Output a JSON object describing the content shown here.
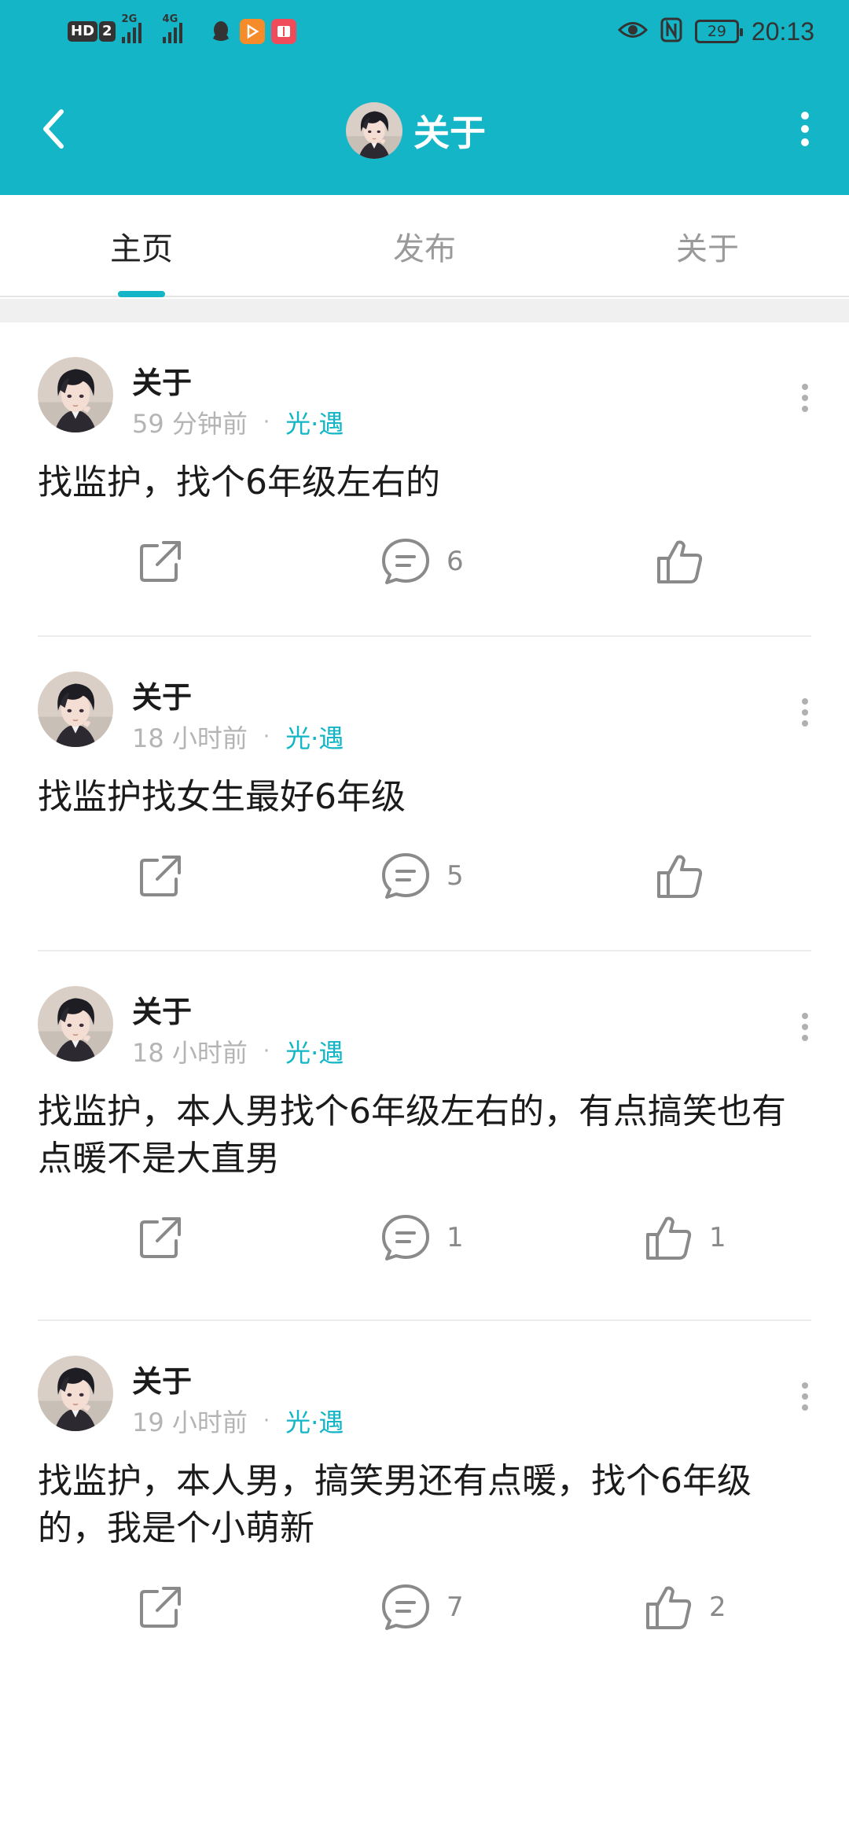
{
  "status_bar": {
    "hd_label": "HD",
    "sim_badge": "2",
    "net1": "2G",
    "net2": "4G",
    "battery": "29",
    "time": "20:13"
  },
  "header": {
    "title": "关于",
    "accent_color": "#13b5c6"
  },
  "tabs": [
    {
      "label": "主页",
      "active": true
    },
    {
      "label": "发布",
      "active": false
    },
    {
      "label": "关于",
      "active": false
    }
  ],
  "posts": [
    {
      "author": "关于",
      "time": "59 分钟前",
      "dot": "·",
      "tag": "光·遇",
      "text": "找监护，找个6年级左右的",
      "comments": "6",
      "likes": ""
    },
    {
      "author": "关于",
      "time": "18 小时前",
      "dot": "·",
      "tag": "光·遇",
      "text": "找监护找女生最好6年级",
      "comments": "5",
      "likes": ""
    },
    {
      "author": "关于",
      "time": "18 小时前",
      "dot": "·",
      "tag": "光·遇",
      "text": "找监护，本人男找个6年级左右的，有点搞笑也有点暖不是大直男",
      "comments": "1",
      "likes": "1"
    },
    {
      "author": "关于",
      "time": "19 小时前",
      "dot": "·",
      "tag": "光·遇",
      "text": "找监护，本人男，搞笑男还有点暖，找个6年级的，我是个小萌新",
      "comments": "7",
      "likes": "2"
    }
  ],
  "icons": {
    "back": "chevron-left-icon",
    "more": "more-vertical-icon",
    "share": "share-icon",
    "comment": "comment-icon",
    "like": "thumbs-up-icon"
  }
}
